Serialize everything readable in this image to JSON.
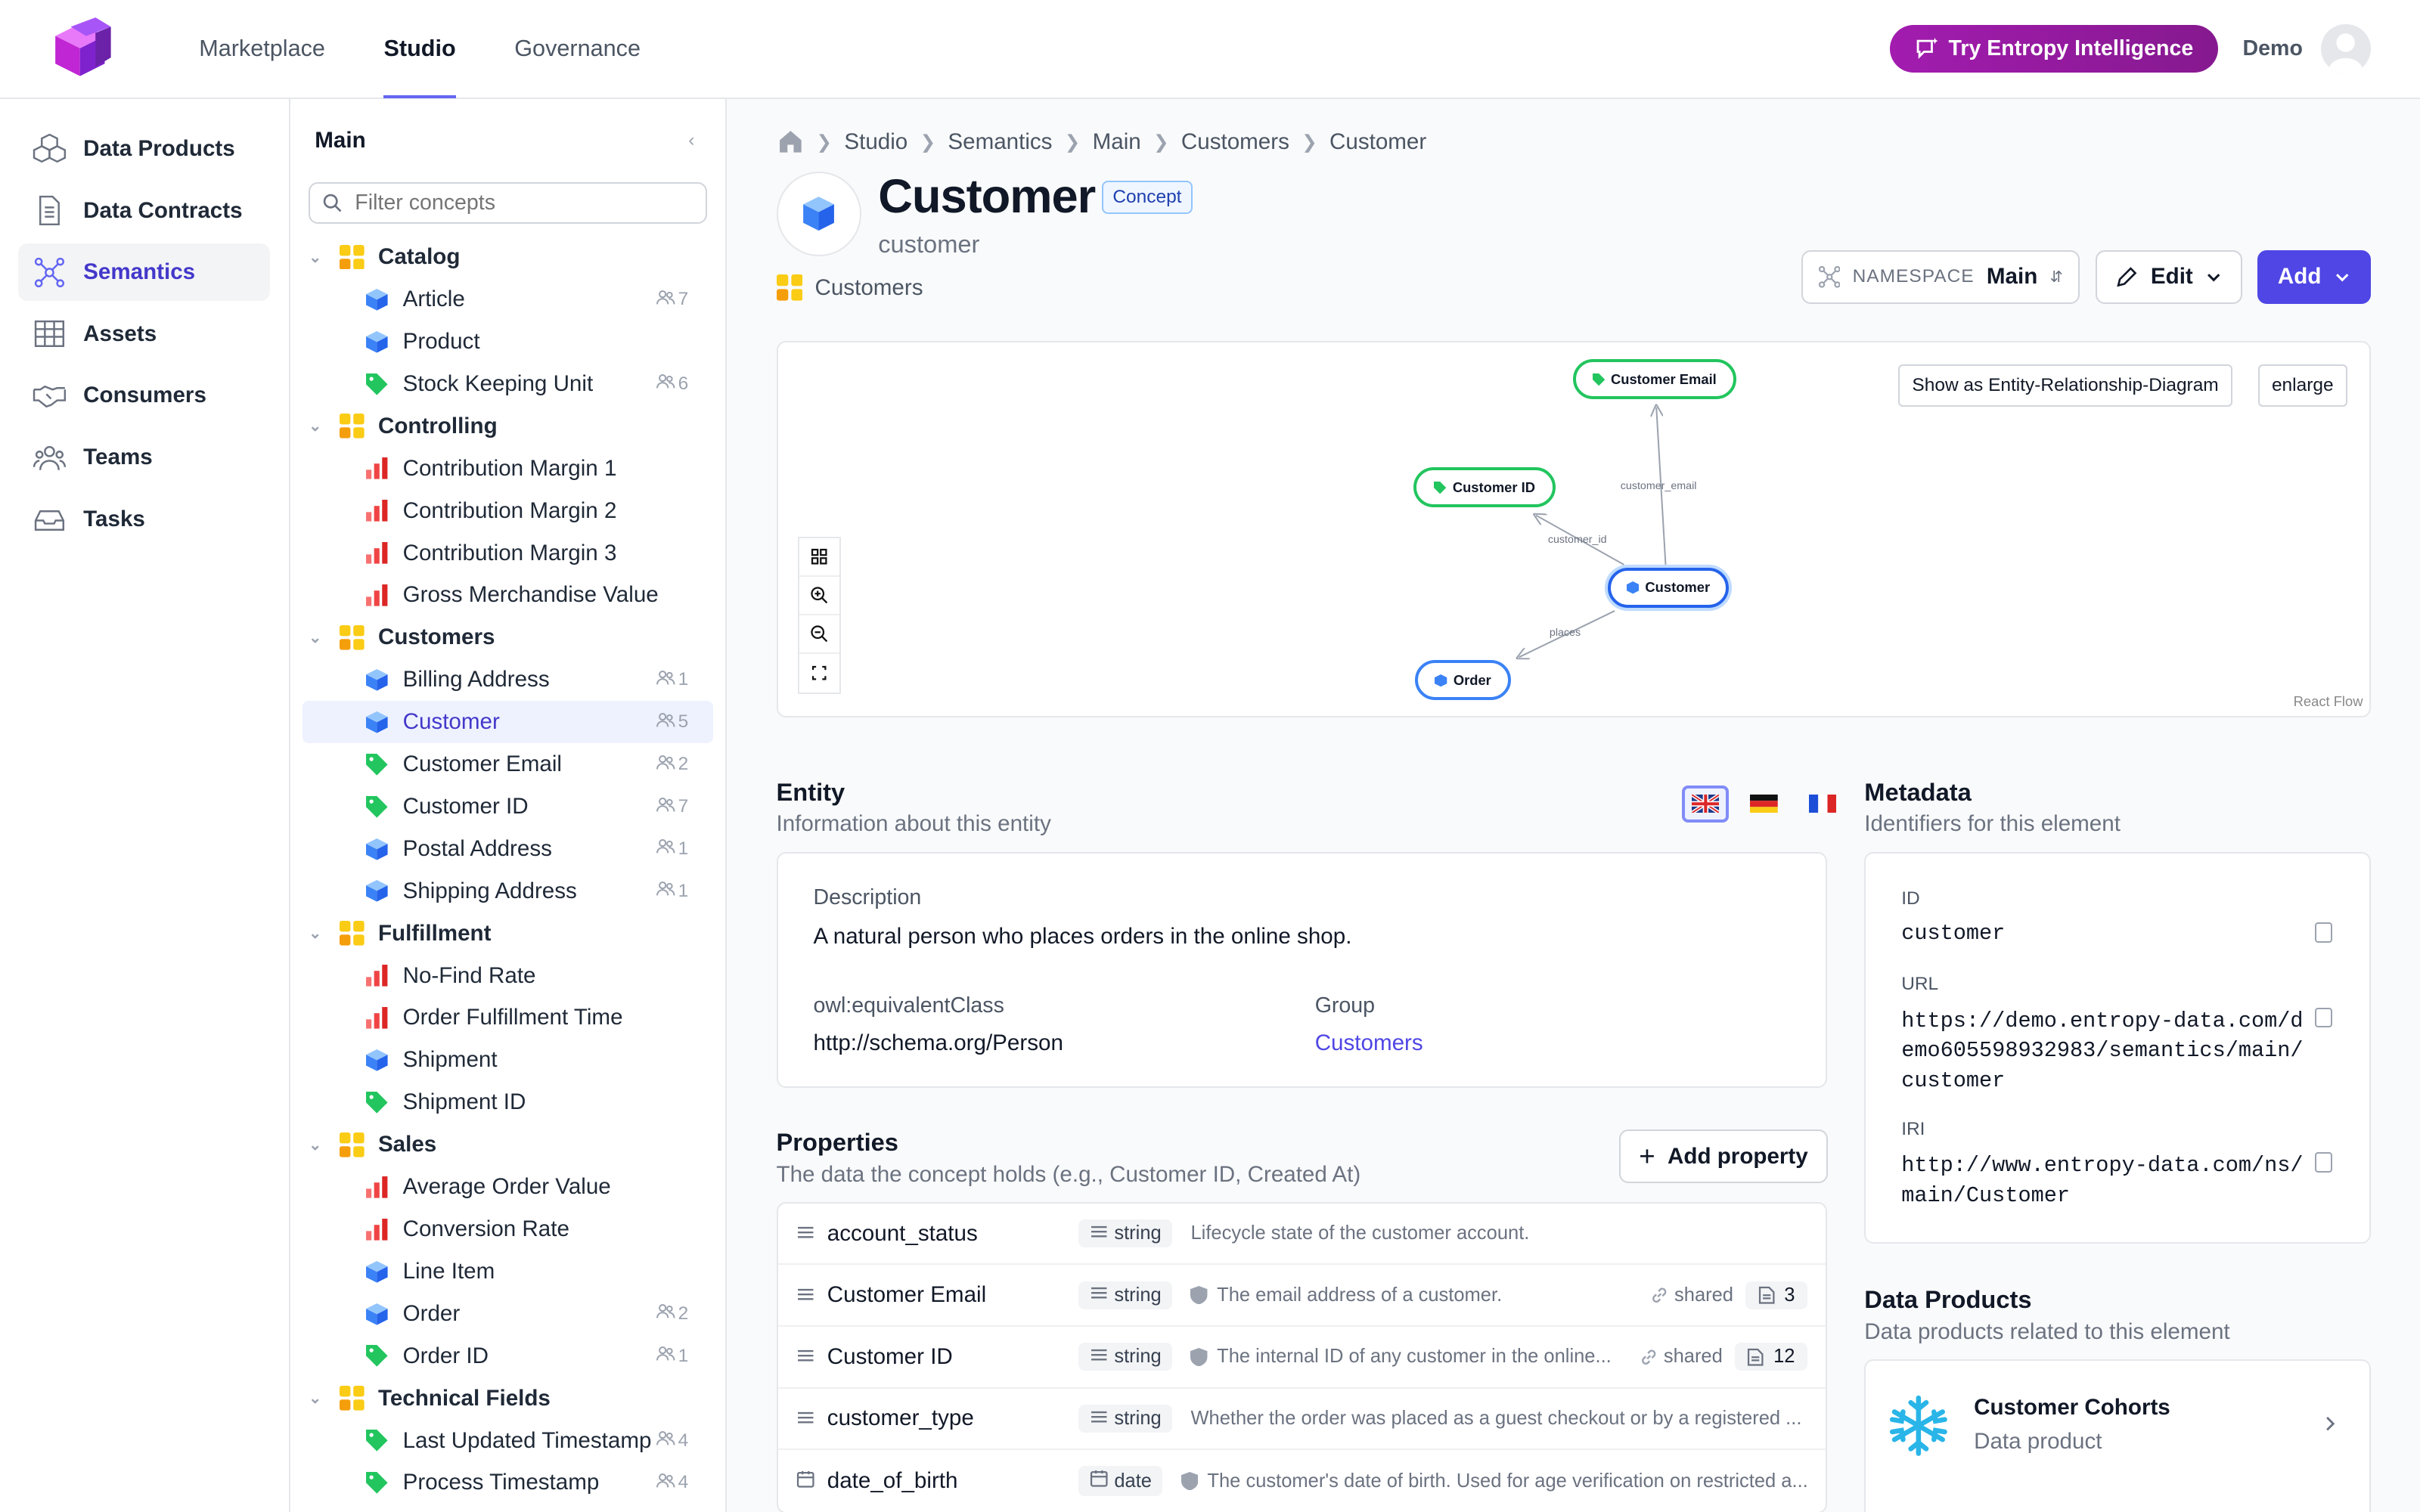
{
  "topnav": {
    "items": [
      "Marketplace",
      "Studio",
      "Governance"
    ],
    "try_label": "Try Entropy Intelligence",
    "user": "Demo"
  },
  "sidebar": {
    "items": [
      "Data Products",
      "Data Contracts",
      "Semantics",
      "Assets",
      "Consumers",
      "Teams",
      "Tasks"
    ]
  },
  "tree": {
    "title": "Main",
    "filter_placeholder": "Filter concepts",
    "groups": [
      {
        "name": "Catalog",
        "items": [
          {
            "label": "Article",
            "icon": "cube",
            "count": "7"
          },
          {
            "label": "Product",
            "icon": "cube",
            "count": ""
          },
          {
            "label": "Stock Keeping Unit",
            "icon": "tag",
            "count": "6"
          }
        ]
      },
      {
        "name": "Controlling",
        "items": [
          {
            "label": "Contribution Margin 1",
            "icon": "bar",
            "count": ""
          },
          {
            "label": "Contribution Margin 2",
            "icon": "bar",
            "count": ""
          },
          {
            "label": "Contribution Margin 3",
            "icon": "bar",
            "count": ""
          },
          {
            "label": "Gross Merchandise Value",
            "icon": "bar",
            "count": ""
          }
        ]
      },
      {
        "name": "Customers",
        "items": [
          {
            "label": "Billing Address",
            "icon": "cube",
            "count": "1"
          },
          {
            "label": "Customer",
            "icon": "cube",
            "count": "5",
            "active": true
          },
          {
            "label": "Customer Email",
            "icon": "tag",
            "count": "2"
          },
          {
            "label": "Customer ID",
            "icon": "tag",
            "count": "7"
          },
          {
            "label": "Postal Address",
            "icon": "cube",
            "count": "1"
          },
          {
            "label": "Shipping Address",
            "icon": "cube",
            "count": "1"
          }
        ]
      },
      {
        "name": "Fulfillment",
        "items": [
          {
            "label": "No-Find Rate",
            "icon": "bar",
            "count": ""
          },
          {
            "label": "Order Fulfillment Time",
            "icon": "bar",
            "count": ""
          },
          {
            "label": "Shipment",
            "icon": "cube",
            "count": ""
          },
          {
            "label": "Shipment ID",
            "icon": "tag",
            "count": ""
          }
        ]
      },
      {
        "name": "Sales",
        "items": [
          {
            "label": "Average Order Value",
            "icon": "bar",
            "count": ""
          },
          {
            "label": "Conversion Rate",
            "icon": "bar",
            "count": ""
          },
          {
            "label": "Line Item",
            "icon": "cube",
            "count": ""
          },
          {
            "label": "Order",
            "icon": "cube",
            "count": "2"
          },
          {
            "label": "Order ID",
            "icon": "tag",
            "count": "1"
          }
        ]
      },
      {
        "name": "Technical Fields",
        "items": [
          {
            "label": "Last Updated Timestamp",
            "icon": "tag",
            "count": "4"
          },
          {
            "label": "Process Timestamp",
            "icon": "tag",
            "count": "4"
          }
        ]
      }
    ]
  },
  "breadcrumbs": [
    "Studio",
    "Semantics",
    "Main",
    "Customers",
    "Customer"
  ],
  "header": {
    "title": "Customer",
    "badge": "Concept",
    "subtitle": "customer",
    "group": "Customers",
    "namespace_label": "NAMESPACE",
    "namespace_value": "Main",
    "edit_label": "Edit",
    "add_label": "Add"
  },
  "graph": {
    "show_erd_label": "Show as Entity-Relationship-Diagram",
    "enlarge_label": "enlarge",
    "attribution": "React Flow",
    "nodes": {
      "email": "Customer Email",
      "id": "Customer ID",
      "customer": "Customer",
      "order": "Order"
    },
    "edges": {
      "email": "customer_email",
      "id": "customer_id",
      "places": "places"
    }
  },
  "entity": {
    "title": "Entity",
    "subtitle": "Information about this entity",
    "description_label": "Description",
    "description": "A natural person who places orders in the online shop.",
    "equiv_label": "owl:equivalentClass",
    "equiv_value": "http://schema.org/Person",
    "group_label": "Group",
    "group_value": "Customers"
  },
  "metadata": {
    "title": "Metadata",
    "subtitle": "Identifiers for this element",
    "id_label": "ID",
    "id_value": "customer",
    "url_label": "URL",
    "url_value": "https://demo.entropy-data.com/demo605598932983/semantics/main/customer",
    "iri_label": "IRI",
    "iri_value": "http://www.entropy-data.com/ns/main/Customer"
  },
  "properties": {
    "title": "Properties",
    "subtitle": "The data the concept holds (e.g., Customer ID, Created At)",
    "add_label": "Add property",
    "rows": [
      {
        "name": "account_status",
        "type": "string",
        "desc": "Lifecycle state of the customer account.",
        "shield": false,
        "shared": "",
        "count": ""
      },
      {
        "name": "Customer Email",
        "type": "string",
        "desc": "The email address of a customer.",
        "shield": true,
        "shared": "shared",
        "count": "3"
      },
      {
        "name": "Customer ID",
        "type": "string",
        "desc": "The internal ID of any customer in the online...",
        "shield": true,
        "shared": "shared",
        "count": "12"
      },
      {
        "name": "customer_type",
        "type": "string",
        "desc": "Whether the order was placed as a guest checkout or by a registered ...",
        "shield": false,
        "shared": "",
        "count": ""
      },
      {
        "name": "date_of_birth",
        "type": "date",
        "desc": "The customer's date of birth. Used for age verification on restricted a...",
        "shield": true,
        "shared": "",
        "count": ""
      }
    ]
  },
  "data_products": {
    "title": "Data Products",
    "subtitle": "Data products related to this element",
    "items": [
      {
        "name": "Customer Cohorts",
        "type": "Data product"
      }
    ]
  }
}
